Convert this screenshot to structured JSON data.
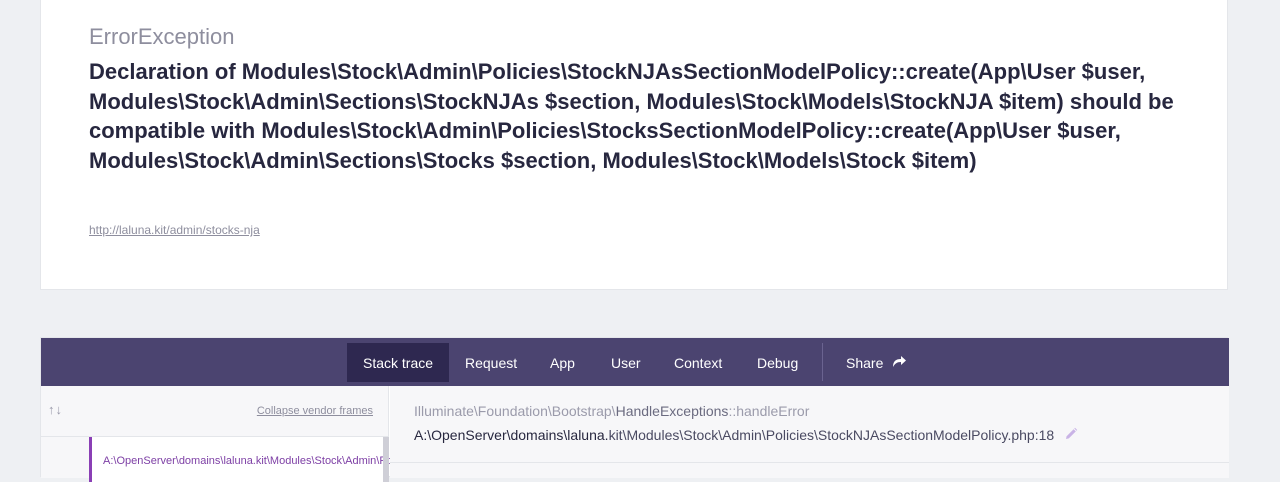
{
  "error": {
    "exception_class": "ErrorException",
    "message": "Declaration of Modules\\Stock\\Admin\\Policies\\StockNJAsSectionModelPolicy::create(App\\User $user, Modules\\Stock\\Admin\\Sections\\StockNJAs $section, Modules\\Stock\\Models\\StockNJA $item) should be compatible with Modules\\Stock\\Admin\\Policies\\StocksSectionModelPolicy::create(App\\User $user, Modules\\Stock\\Admin\\Sections\\Stocks $section, Modules\\Stock\\Models\\Stock $item)",
    "url": "http://laluna.kit/admin/stocks-nja"
  },
  "tabs": {
    "stack_trace": "Stack trace",
    "request": "Request",
    "app": "App",
    "user": "User",
    "context": "Context",
    "debug": "Debug",
    "share": "Share"
  },
  "sidebar": {
    "sort_icon": "↑↓",
    "collapse_label": "Collapse vendor frames",
    "frames": [
      {
        "path": "A:\\OpenServer\\domains\\laluna.kit\\Modules\\Stock\\Admin\\Policies\\StockNJAsSectionModelPolicy.php"
      }
    ]
  },
  "frame": {
    "namespace": "Illuminate\\Foundation\\Bootstrap\\",
    "class_name": "HandleExceptions",
    "method": "::handleError",
    "file_prefix": "A:\\OpenServer\\domains\\laluna.",
    "file_rest": "kit\\Modules\\Stock\\Admin\\Policies\\StockNJAsSectionModelPolicy.php:18"
  },
  "icons": {
    "share": "share-arrow-icon",
    "edit": "pencil-icon",
    "sort": "sort-arrows-icon"
  },
  "colors": {
    "tabbar": "#4b4470",
    "active_tab": "#2e2850",
    "accent": "#8a3fb5"
  }
}
